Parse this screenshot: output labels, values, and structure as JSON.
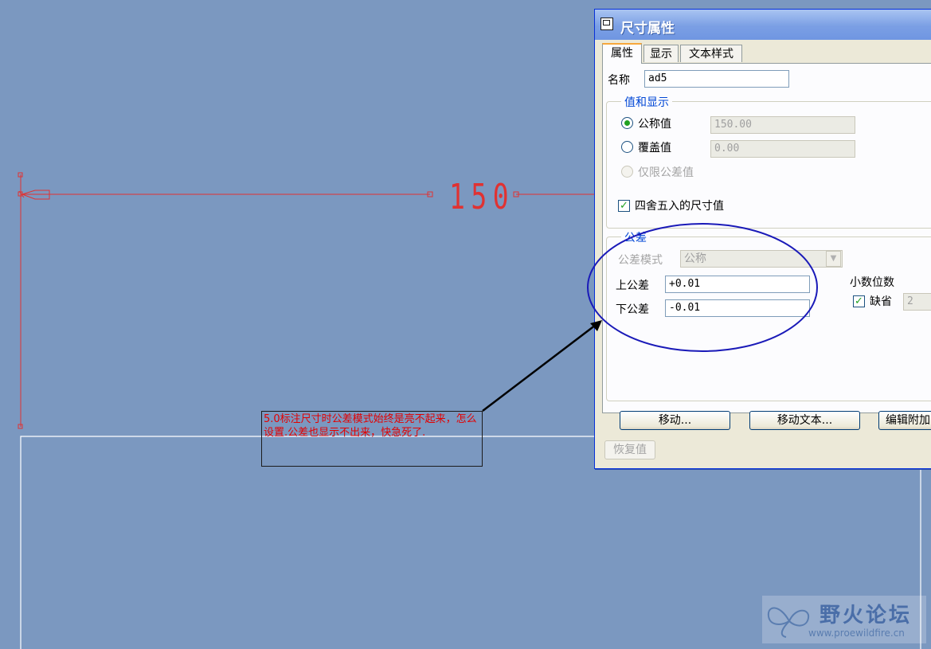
{
  "canvas": {
    "dimension_value": "150"
  },
  "note": {
    "text": "5.0标注尺寸时公差模式始终是亮不起来，怎么设置.公差也显示不出来，快急死了."
  },
  "dialog": {
    "title": "尺寸属性",
    "tabs": [
      {
        "label": "属性",
        "active": true
      },
      {
        "label": "显示",
        "active": false
      },
      {
        "label": "文本样式",
        "active": false
      }
    ],
    "name_label": "名称",
    "name_value": "ad5",
    "value_group": {
      "title": "值和显示",
      "nominal_label": "公称值",
      "nominal_value": "150.00",
      "override_label": "覆盖值",
      "override_value": "0.00",
      "tolerance_only_label": "仅限公差值",
      "selected": "公称值"
    },
    "round_label": "四舍五入的尺寸值",
    "round_checked": true,
    "tolerance_group": {
      "title": "公差",
      "mode_label": "公差模式",
      "mode_value": "公称",
      "upper_label": "上公差",
      "upper_value": "+0.01",
      "lower_label": "下公差",
      "lower_value": "-0.01"
    },
    "decimals": {
      "label": "小数位数",
      "default_label": "缺省",
      "default_checked": true,
      "value": "2"
    },
    "buttons": {
      "move": "移动...",
      "move_text": "移动文本...",
      "edit_attach": "编辑附加",
      "restore": "恢复值"
    }
  },
  "watermark": {
    "title": "野火论坛",
    "url": "www.proewildfire.cn"
  },
  "colors": {
    "background": "#7b98c0",
    "dimension_red": "#e03232",
    "highlight_ellipse": "#1a1ab8"
  }
}
